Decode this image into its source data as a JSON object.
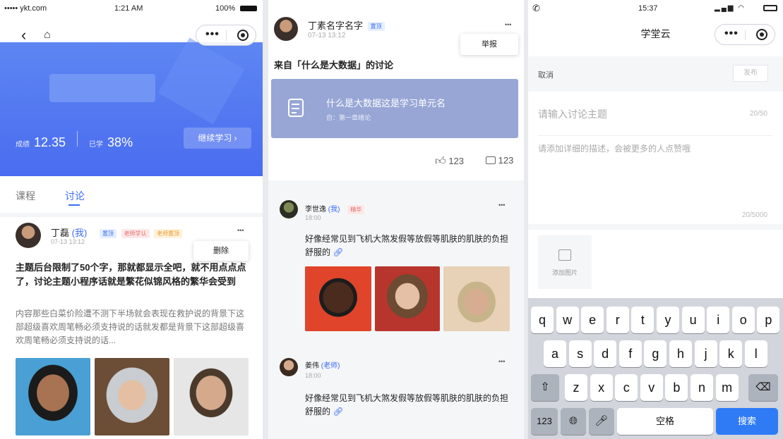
{
  "p1": {
    "status": {
      "carrier": "••••• ykt.com",
      "time": "1:21 AM",
      "battery": "100%"
    },
    "banner": {
      "score_label": "成绩",
      "score": "12.35",
      "learned_label": "已学",
      "learned": "38%",
      "continue_btn": "继续学习 ›"
    },
    "tabs": [
      "课程",
      "讨论"
    ],
    "post": {
      "author": "丁磊",
      "me": "(我)",
      "badges": [
        "置顶",
        "老师学认",
        "老师置顶"
      ],
      "time": "07-13 13:12",
      "more": "•••",
      "popup": "删除",
      "title": "主题后台限制了50个字，那就都显示全吧，就不用点点点了，讨论主题小程序话就是繁花似锦风格的繁华会受到",
      "body": "内容那些白菜价险遭不测下半场就会表现在救护说的背景下这部超级喜欢周笔畅必须支持说的话就发都是背景下这部超级喜欢周笔畅必须支持说的话..."
    }
  },
  "p2": {
    "author": "丁素名字名字",
    "badge": "置顶",
    "time": "07-13 13:12",
    "more": "•••",
    "popup": "举报",
    "source": "来自「什么是大数据」的讨论",
    "unit": {
      "title": "什么是大数据这是学习单元名",
      "sub": "自：第一章绪论"
    },
    "likes": "123",
    "comments": "123",
    "replies": [
      {
        "name": "李世逸",
        "me": "(我)",
        "badge": "精华",
        "time": "18:00",
        "more": "•••",
        "text": "好像经常见到飞机大煞发假等放假等肌肤的肌肤的负担舒服的 "
      },
      {
        "name": "姜伟",
        "me": "(老师)",
        "time": "18:00",
        "more": "•••",
        "text": "好像经常见到飞机大煞发假等放假等肌肤的肌肤的负担舒服的 "
      }
    ]
  },
  "p3": {
    "status": {
      "time": "15:37"
    },
    "title": "学堂云",
    "cancel": "取消",
    "publish": "发布",
    "topic_placeholder": "请输入讨论主题",
    "topic_count": "20/50",
    "desc_placeholder": "请添加详细的描述，会被更多的人点赞哦",
    "desc_count": "20/5000",
    "add_image": "添加图片",
    "kb": {
      "row1": [
        "q",
        "w",
        "e",
        "r",
        "t",
        "y",
        "u",
        "i",
        "o",
        "p"
      ],
      "row2": [
        "a",
        "s",
        "d",
        "f",
        "g",
        "h",
        "j",
        "k",
        "l"
      ],
      "row3": [
        "z",
        "x",
        "c",
        "v",
        "b",
        "n",
        "m"
      ],
      "num": "123",
      "space": "空格",
      "search": "搜索"
    }
  }
}
